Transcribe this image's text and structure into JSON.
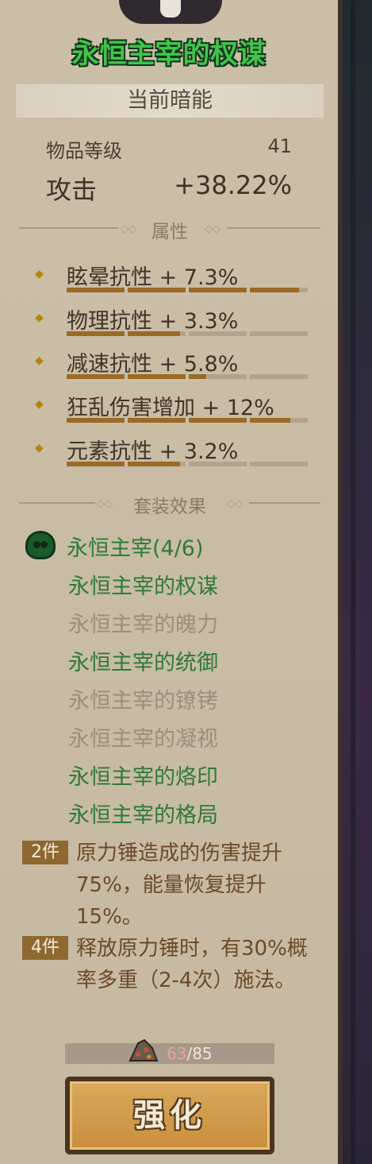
{
  "item": {
    "title": "永恒主宰的权谋",
    "section": "当前暗能",
    "level_label": "物品等级",
    "level_value": "41",
    "attack_label": "攻击",
    "attack_value": "+38.22%"
  },
  "attributes": {
    "header": "属性",
    "items": [
      {
        "text": "眩晕抗性 + 7.3%",
        "fill": [
          1,
          1,
          1,
          0.85
        ]
      },
      {
        "text": "物理抗性 + 3.3%",
        "fill": [
          1,
          0.9,
          0,
          0
        ]
      },
      {
        "text": "减速抗性 + 5.8%",
        "fill": [
          1,
          1,
          0.3,
          0
        ]
      },
      {
        "text": "狂乱伤害增加 + 12%",
        "fill": [
          1,
          1,
          1,
          0.7
        ]
      },
      {
        "text": "元素抗性 + 3.2%",
        "fill": [
          1,
          0.9,
          0,
          0
        ]
      }
    ]
  },
  "set": {
    "header": "套装效果",
    "name": "永恒主宰(4/6)",
    "pieces": [
      {
        "name": "永恒主宰的权谋",
        "owned": true
      },
      {
        "name": "永恒主宰的魄力",
        "owned": false
      },
      {
        "name": "永恒主宰的统御",
        "owned": true
      },
      {
        "name": "永恒主宰的镣铐",
        "owned": false
      },
      {
        "name": "永恒主宰的凝视",
        "owned": false
      },
      {
        "name": "永恒主宰的烙印",
        "owned": true
      },
      {
        "name": "永恒主宰的格局",
        "owned": true
      }
    ],
    "bonuses": [
      {
        "tag": "2件",
        "desc": "原力锤造成的伤害提升75%，能量恢复提升15%。"
      },
      {
        "tag": "4件",
        "desc": "释放原力锤时，有30%概率多重（2-4次）施法。"
      }
    ]
  },
  "material": {
    "icon": "ore-pile-icon",
    "current": "63",
    "separator": "/",
    "required": "85"
  },
  "upgrade_button": {
    "label": "强化"
  },
  "colors": {
    "panel": "#c9bca5",
    "title_green": "#42c44a",
    "owned_green": "#2f7a37",
    "unowned_gray": "#9a8e7e",
    "bar_fill": "#9a6a26",
    "button": "#d9a95c"
  }
}
